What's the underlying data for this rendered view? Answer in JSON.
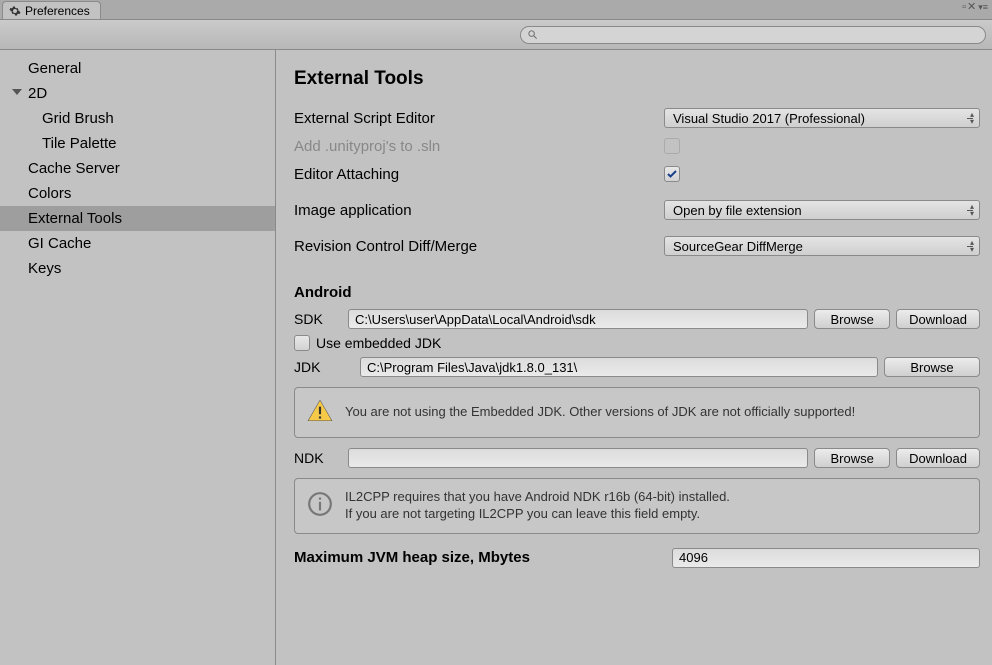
{
  "tab_title": "Preferences",
  "search_placeholder": "",
  "sidebar": {
    "items": [
      {
        "label": "General",
        "level": 0
      },
      {
        "label": "2D",
        "level": 0,
        "expandable": true
      },
      {
        "label": "Grid Brush",
        "level": 1
      },
      {
        "label": "Tile Palette",
        "level": 1
      },
      {
        "label": "Cache Server",
        "level": 0
      },
      {
        "label": "Colors",
        "level": 0
      },
      {
        "label": "External Tools",
        "level": 0,
        "selected": true
      },
      {
        "label": "GI Cache",
        "level": 0
      },
      {
        "label": "Keys",
        "level": 0
      }
    ]
  },
  "main": {
    "title": "External Tools",
    "ext_script_editor_label": "External Script Editor",
    "ext_script_editor_value": "Visual Studio 2017 (Professional)",
    "add_unityproj_label": "Add .unityproj's to .sln",
    "editor_attaching_label": "Editor Attaching",
    "editor_attaching_checked": true,
    "image_app_label": "Image application",
    "image_app_value": "Open by file extension",
    "rev_control_label": "Revision Control Diff/Merge",
    "rev_control_value": "SourceGear DiffMerge",
    "android_header": "Android",
    "sdk_label": "SDK",
    "sdk_value": "C:\\Users\\user\\AppData\\Local\\Android\\sdk",
    "browse_label": "Browse",
    "download_label": "Download",
    "use_embedded_jdk_label": "Use embedded JDK",
    "jdk_label": "JDK",
    "jdk_value": "C:\\Program Files\\Java\\jdk1.8.0_131\\",
    "jdk_warning": "You are not using the Embedded JDK. Other versions of JDK are not officially supported!",
    "ndk_label": "NDK",
    "ndk_value": "",
    "ndk_info_line1": "IL2CPP requires that you have Android NDK r16b (64-bit) installed.",
    "ndk_info_line2": "If you are not targeting IL2CPP you can leave this field empty.",
    "heap_label": "Maximum JVM heap size, Mbytes",
    "heap_value": "4096"
  }
}
